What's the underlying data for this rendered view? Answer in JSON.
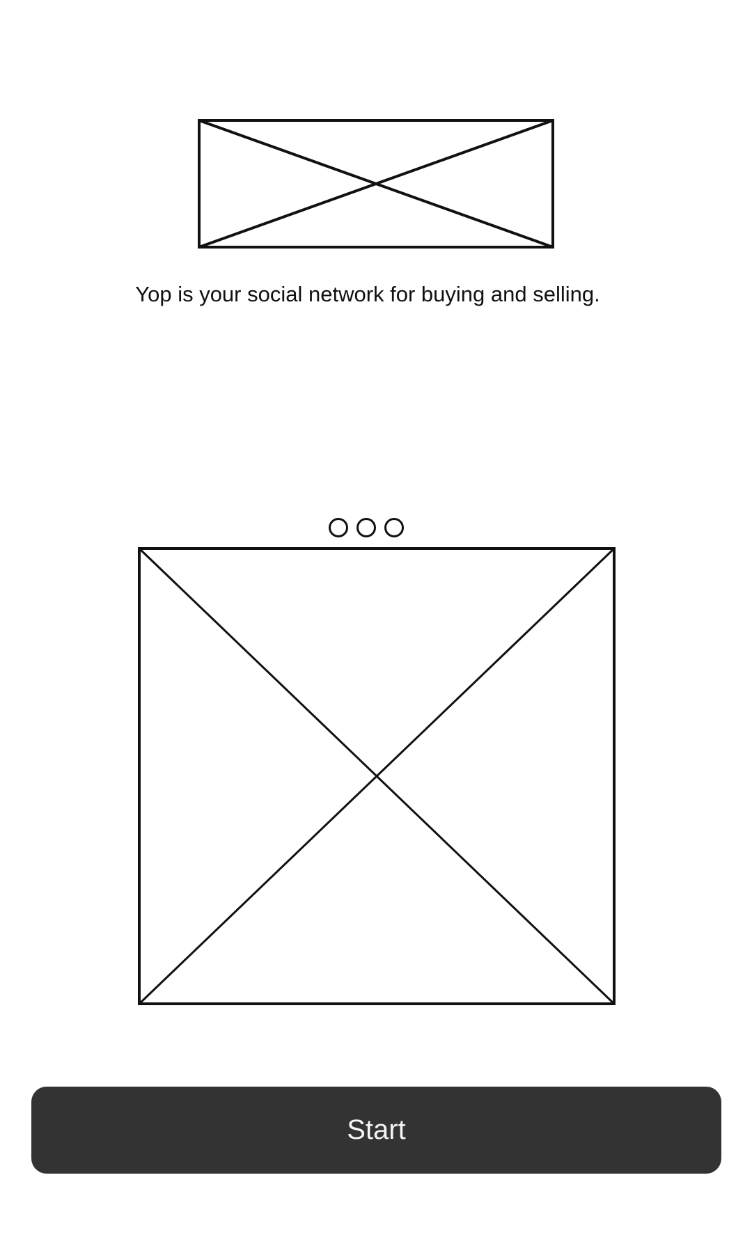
{
  "logo": {
    "icon": "image-placeholder-icon"
  },
  "intro": {
    "tagline": "Yop is your social network for buying and selling."
  },
  "carousel": {
    "page_count": 3,
    "icon": "image-placeholder-icon"
  },
  "actions": {
    "start_label": "Start"
  },
  "colors": {
    "button_background": "#333333",
    "button_text": "#f5f5f5",
    "stroke": "#111111",
    "page_background": "#ffffff"
  }
}
